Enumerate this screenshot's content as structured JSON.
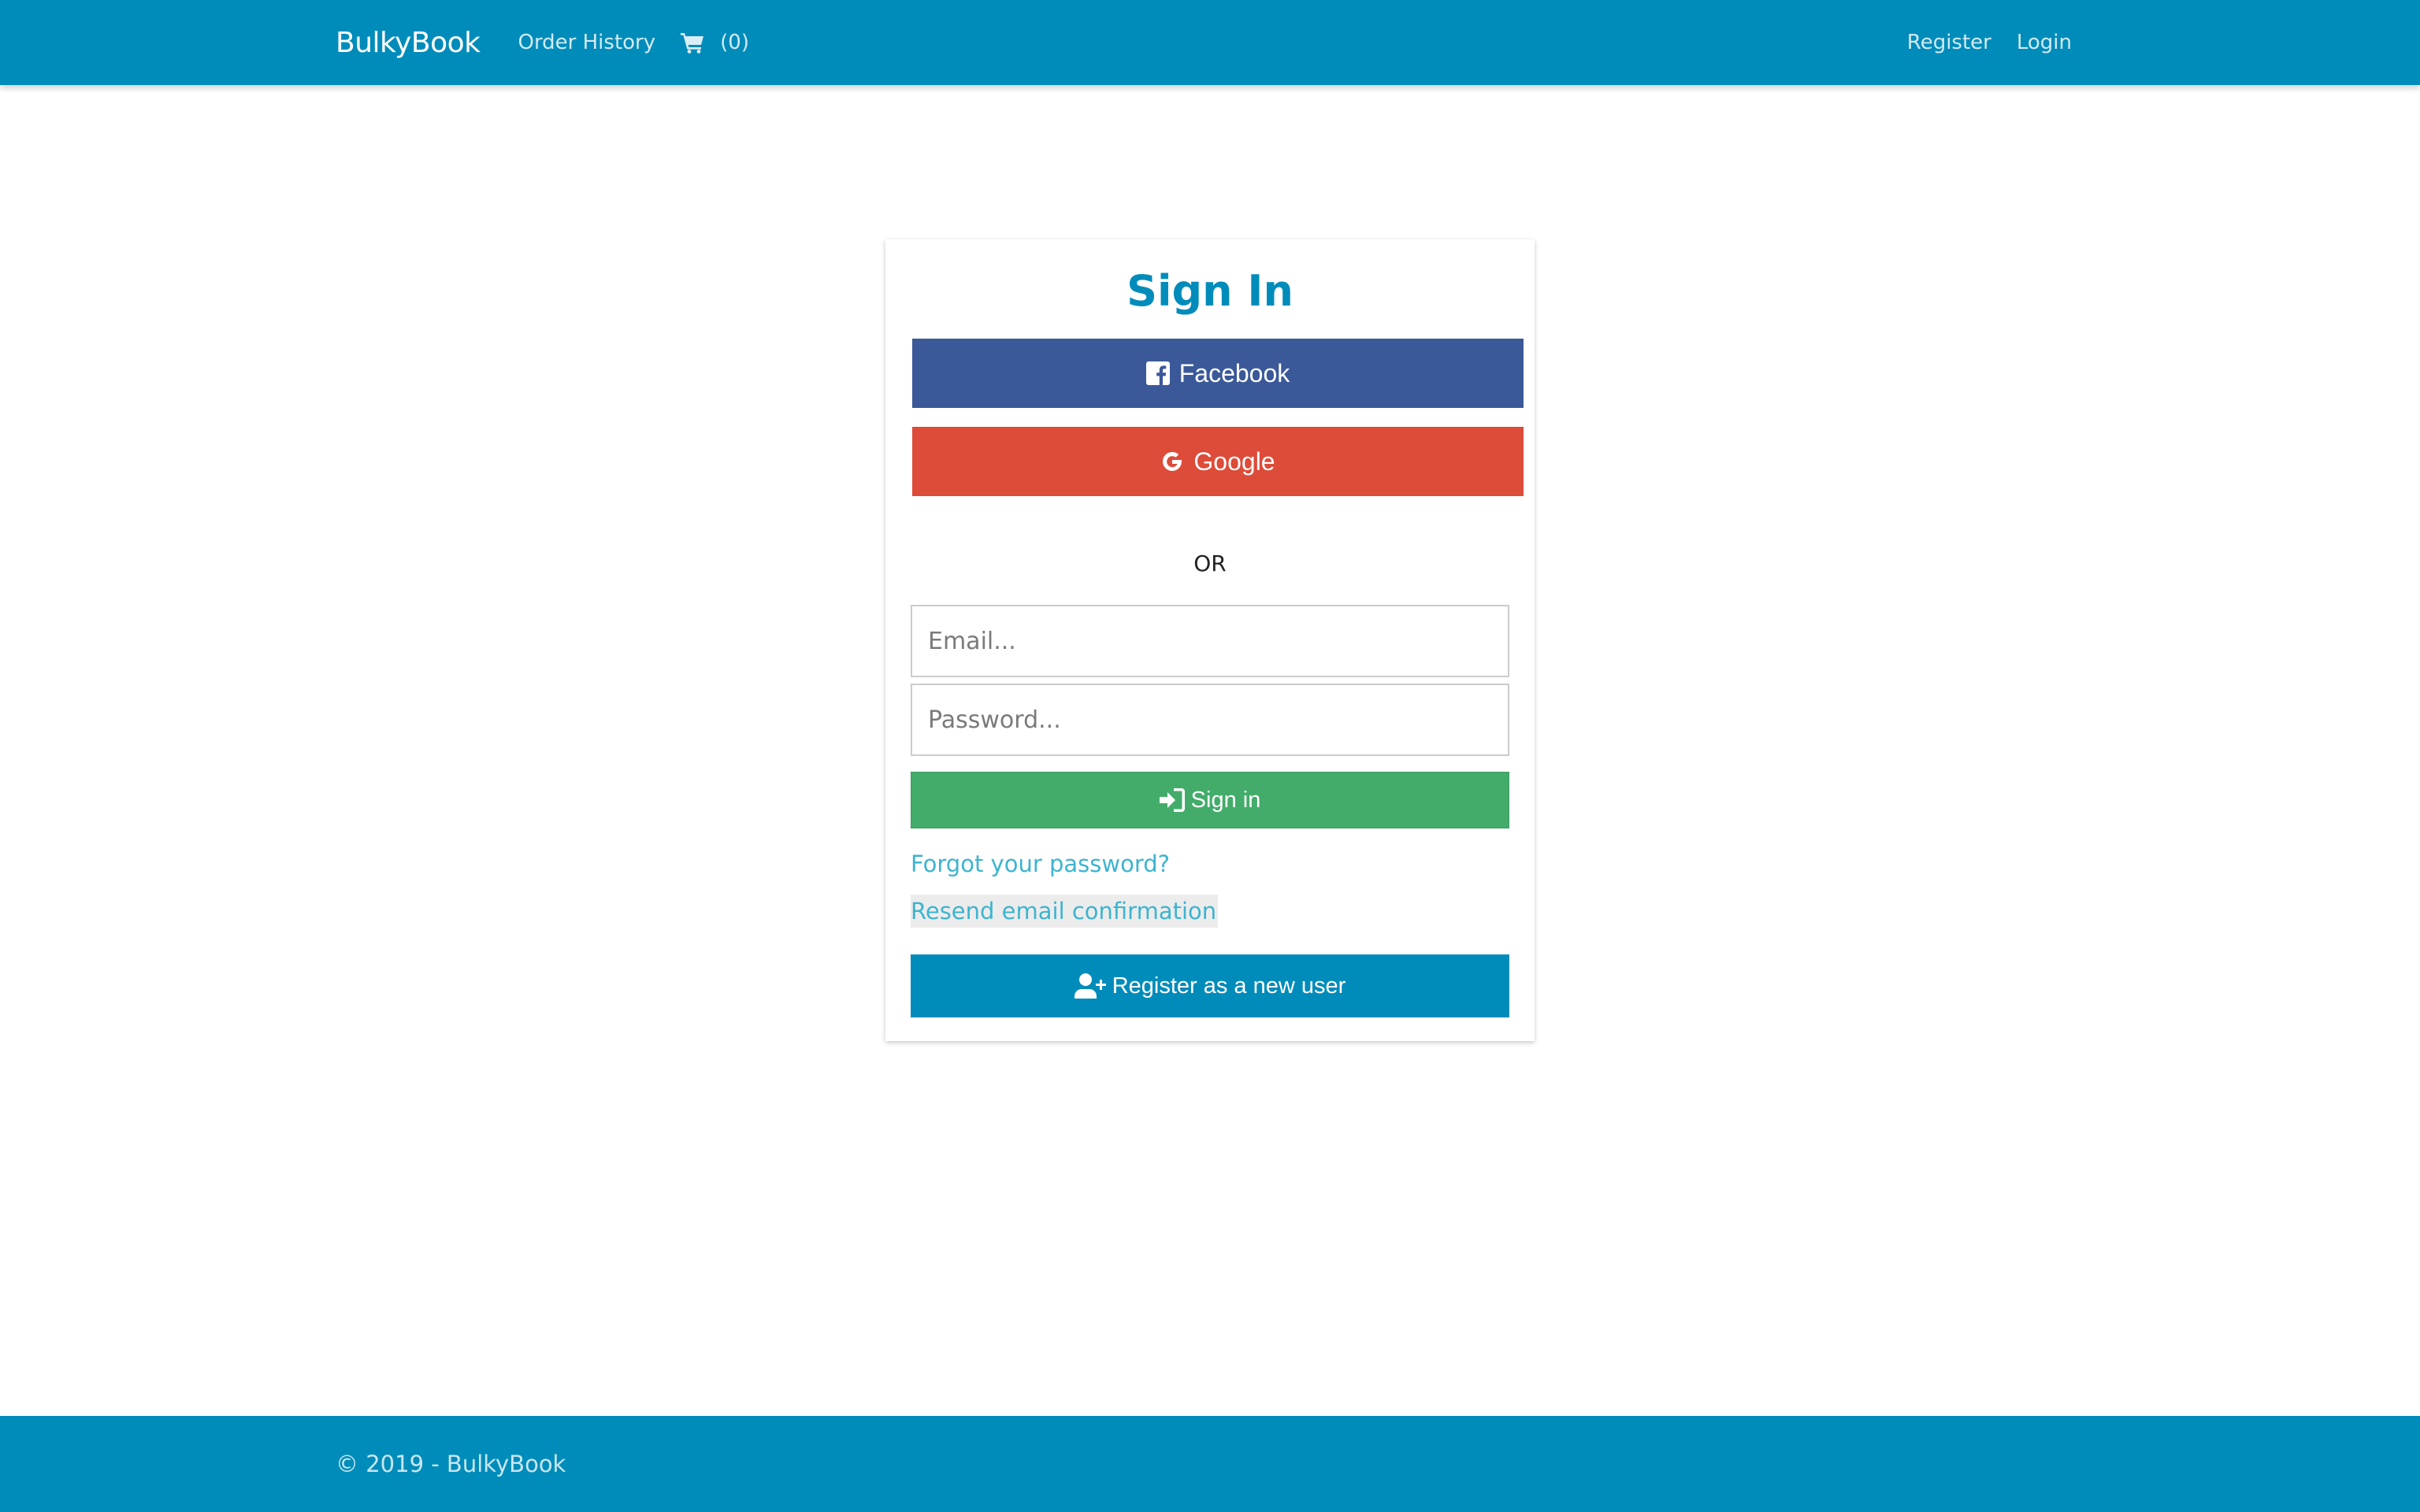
{
  "navbar": {
    "brand": "BulkyBook",
    "order_history": "Order History",
    "cart_count": "(0)",
    "register": "Register",
    "login": "Login"
  },
  "signin": {
    "title": "Sign In",
    "facebook_label": "Facebook",
    "google_label": "Google",
    "or_text": "OR",
    "email_placeholder": "Email...",
    "password_placeholder": "Password...",
    "signin_label": "Sign in",
    "forgot_link": "Forgot your password?",
    "resend_link": "Resend email confirmation",
    "register_label": "Register as a new user"
  },
  "footer": {
    "text": "© 2019 - BulkyBook"
  },
  "icons": {
    "cart": "shopping-cart-icon",
    "facebook": "facebook-square-icon",
    "google": "google-icon",
    "signin": "sign-in-icon",
    "register": "user-plus-icon"
  },
  "colors": {
    "primary": "#008cba",
    "facebook": "#3b5999",
    "google": "#dd4b39",
    "success": "#43ac6a",
    "link": "#3db4cf"
  }
}
